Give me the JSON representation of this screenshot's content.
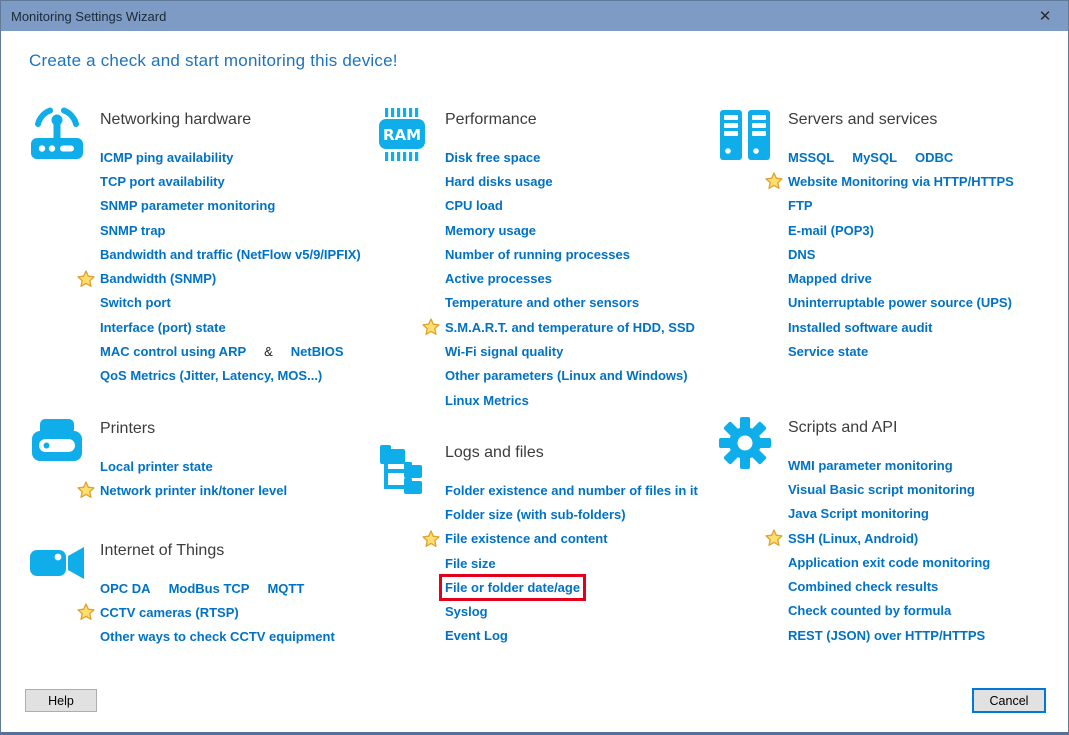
{
  "window": {
    "title": "Monitoring Settings Wizard",
    "close_icon": "✕"
  },
  "heading": "Create a check and start monitoring this device!",
  "colors": {
    "accent_link": "#0072C6",
    "icon_cyan": "#0FAEEA",
    "titlebar": "#7D9BC4",
    "highlight_red": "#E2001A",
    "heading_blue": "#1E73BE",
    "star_gold": "#FFDE6E"
  },
  "columns": [
    {
      "sections": [
        {
          "title": "Networking hardware",
          "icon": "router-icon",
          "items": [
            {
              "label": "ICMP ping availability"
            },
            {
              "label": "TCP port availability"
            },
            {
              "label": "SNMP parameter monitoring"
            },
            {
              "label": "SNMP trap"
            },
            {
              "label": "Bandwidth and traffic (NetFlow v5/9/IPFIX)"
            },
            {
              "star": true,
              "label": "Bandwidth (SNMP)"
            },
            {
              "label": "Switch port"
            },
            {
              "label": "Interface (port) state"
            },
            {
              "parts": [
                {
                  "label": "MAC control using ARP"
                },
                {
                  "text": "&"
                },
                {
                  "label": "NetBIOS"
                }
              ]
            },
            {
              "label": "QoS Metrics (Jitter, Latency, MOS...)"
            }
          ]
        },
        {
          "title": "Printers",
          "icon": "printer-icon",
          "items": [
            {
              "label": "Local printer state"
            },
            {
              "star": true,
              "label": "Network printer ink/toner level"
            }
          ]
        },
        {
          "title": "Internet of Things",
          "icon": "camera-icon",
          "items": [
            {
              "parts": [
                {
                  "label": "OPC DA"
                },
                {
                  "label": "ModBus TCP"
                },
                {
                  "label": "MQTT"
                }
              ]
            },
            {
              "star": true,
              "label": "CCTV cameras (RTSP)"
            },
            {
              "label": "Other ways to check CCTV equipment"
            }
          ]
        }
      ]
    },
    {
      "sections": [
        {
          "title": "Performance",
          "icon": "ram-icon",
          "items": [
            {
              "label": "Disk free space"
            },
            {
              "label": "Hard disks usage"
            },
            {
              "label": "CPU load"
            },
            {
              "label": "Memory usage"
            },
            {
              "label": "Number of running processes"
            },
            {
              "label": "Active processes"
            },
            {
              "label": "Temperature and other sensors"
            },
            {
              "star": true,
              "label": "S.M.A.R.T. and temperature of HDD, SSD"
            },
            {
              "label": "Wi-Fi signal quality"
            },
            {
              "label": "Other parameters (Linux and Windows)"
            },
            {
              "label": "Linux Metrics"
            }
          ]
        },
        {
          "title": "Logs and files",
          "icon": "folder-tree-icon",
          "items": [
            {
              "label": "Folder existence and number of files in it"
            },
            {
              "label": "Folder size (with sub-folders)"
            },
            {
              "star": true,
              "label": "File existence and content"
            },
            {
              "label": "File size"
            },
            {
              "highlight": true,
              "label": "File or folder date/age"
            },
            {
              "label": "Syslog"
            },
            {
              "label": "Event Log"
            }
          ]
        }
      ]
    },
    {
      "sections": [
        {
          "title": "Servers and services",
          "icon": "servers-icon",
          "items": [
            {
              "parts": [
                {
                  "label": "MSSQL"
                },
                {
                  "label": "MySQL"
                },
                {
                  "label": "ODBC"
                }
              ]
            },
            {
              "star": true,
              "label": "Website Monitoring via HTTP/HTTPS"
            },
            {
              "label": "FTP"
            },
            {
              "label": "E-mail (POP3)"
            },
            {
              "label": "DNS"
            },
            {
              "label": "Mapped drive"
            },
            {
              "label": "Uninterruptable power source (UPS)"
            },
            {
              "label": "Installed software audit"
            },
            {
              "label": "Service state"
            }
          ]
        },
        {
          "title": "Scripts and API",
          "icon": "gear-icon",
          "items": [
            {
              "label": "WMI parameter monitoring"
            },
            {
              "label": "Visual Basic script monitoring"
            },
            {
              "label": "Java Script monitoring"
            },
            {
              "star": true,
              "label": "SSH (Linux, Android)"
            },
            {
              "label": "Application exit code monitoring"
            },
            {
              "label": "Combined check results"
            },
            {
              "label": "Check counted by formula"
            },
            {
              "label": "REST (JSON) over HTTP/HTTPS"
            }
          ]
        }
      ]
    }
  ],
  "footer": {
    "help_label": "Help",
    "cancel_label": "Cancel"
  }
}
